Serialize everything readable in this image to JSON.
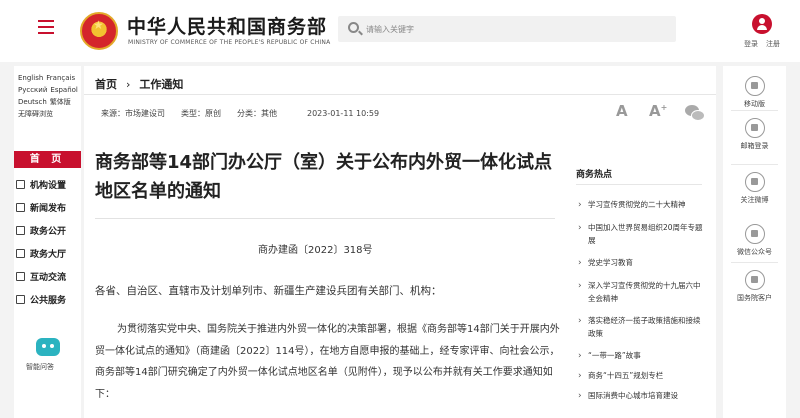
{
  "header": {
    "site_title": "中华人民共和国商务部",
    "site_subtitle": "MINISTRY OF COMMERCE OF THE PEOPLE'S REPUBLIC OF CHINA",
    "search_placeholder": "请输入关键字",
    "login": "登录",
    "register": "注册"
  },
  "languages": {
    "en": "English",
    "fr": "Français",
    "ru": "Русский",
    "es": "Español",
    "de": "Deutsch",
    "trad": "繁体版",
    "access": "无障碍浏览"
  },
  "nav": {
    "home": "首 页",
    "items": [
      {
        "label": "机构设置",
        "icon": "org-icon"
      },
      {
        "label": "新闻发布",
        "icon": "news-icon"
      },
      {
        "label": "政务公开",
        "icon": "doc-icon"
      },
      {
        "label": "政务大厅",
        "icon": "hall-icon"
      },
      {
        "label": "互动交流",
        "icon": "chat-icon"
      },
      {
        "label": "公共服务",
        "icon": "plus-icon"
      }
    ],
    "assistant": "智能问答"
  },
  "breadcrumb": {
    "home": "首页",
    "sep": "›",
    "current": "工作通知"
  },
  "meta": {
    "source": "来源：市场建设司",
    "type": "类型：原创",
    "category": "分类：其他",
    "date": "2023-01-11 10:59"
  },
  "tools": {
    "font_down": "A",
    "font_up": "A",
    "font_up_sign": "+"
  },
  "article": {
    "title": "商务部等14部门办公厅（室）关于公布内外贸一体化试点地区名单的通知",
    "doc_number": "商办建函〔2022〕318号",
    "addressee": "各省、自治区、直辖市及计划单列市、新疆生产建设兵团有关部门、机构：",
    "paragraph": "为贯彻落实党中央、国务院关于推进内外贸一体化的决策部署，根据《商务部等14部门关于开展内外贸一体化试点的通知》（商建函〔2022〕114号），在地方自愿申报的基础上，经专家评审、向社会公示，商务部等14部门研究确定了内外贸一体化试点地区名单（见附件），现予以公布并就有关工作要求通知如下："
  },
  "hot": {
    "title": "商务热点",
    "items": [
      "学习宣传贯彻党的二十大精神",
      "中国加入世界贸易组织20周年专题展",
      "党史学习教育",
      "深入学习宣传贯彻党的十九届六中全会精神",
      "落实稳经济一揽子政策措施和接续政策",
      "“一带一路”故事",
      "商务“十四五”规划专栏",
      "国际消费中心城市培育建设"
    ]
  },
  "share": {
    "mobile": "移动版",
    "email": "邮箱登录",
    "weibo": "关注微博",
    "wechat": "微信公众号",
    "tips": "国务院客户"
  }
}
